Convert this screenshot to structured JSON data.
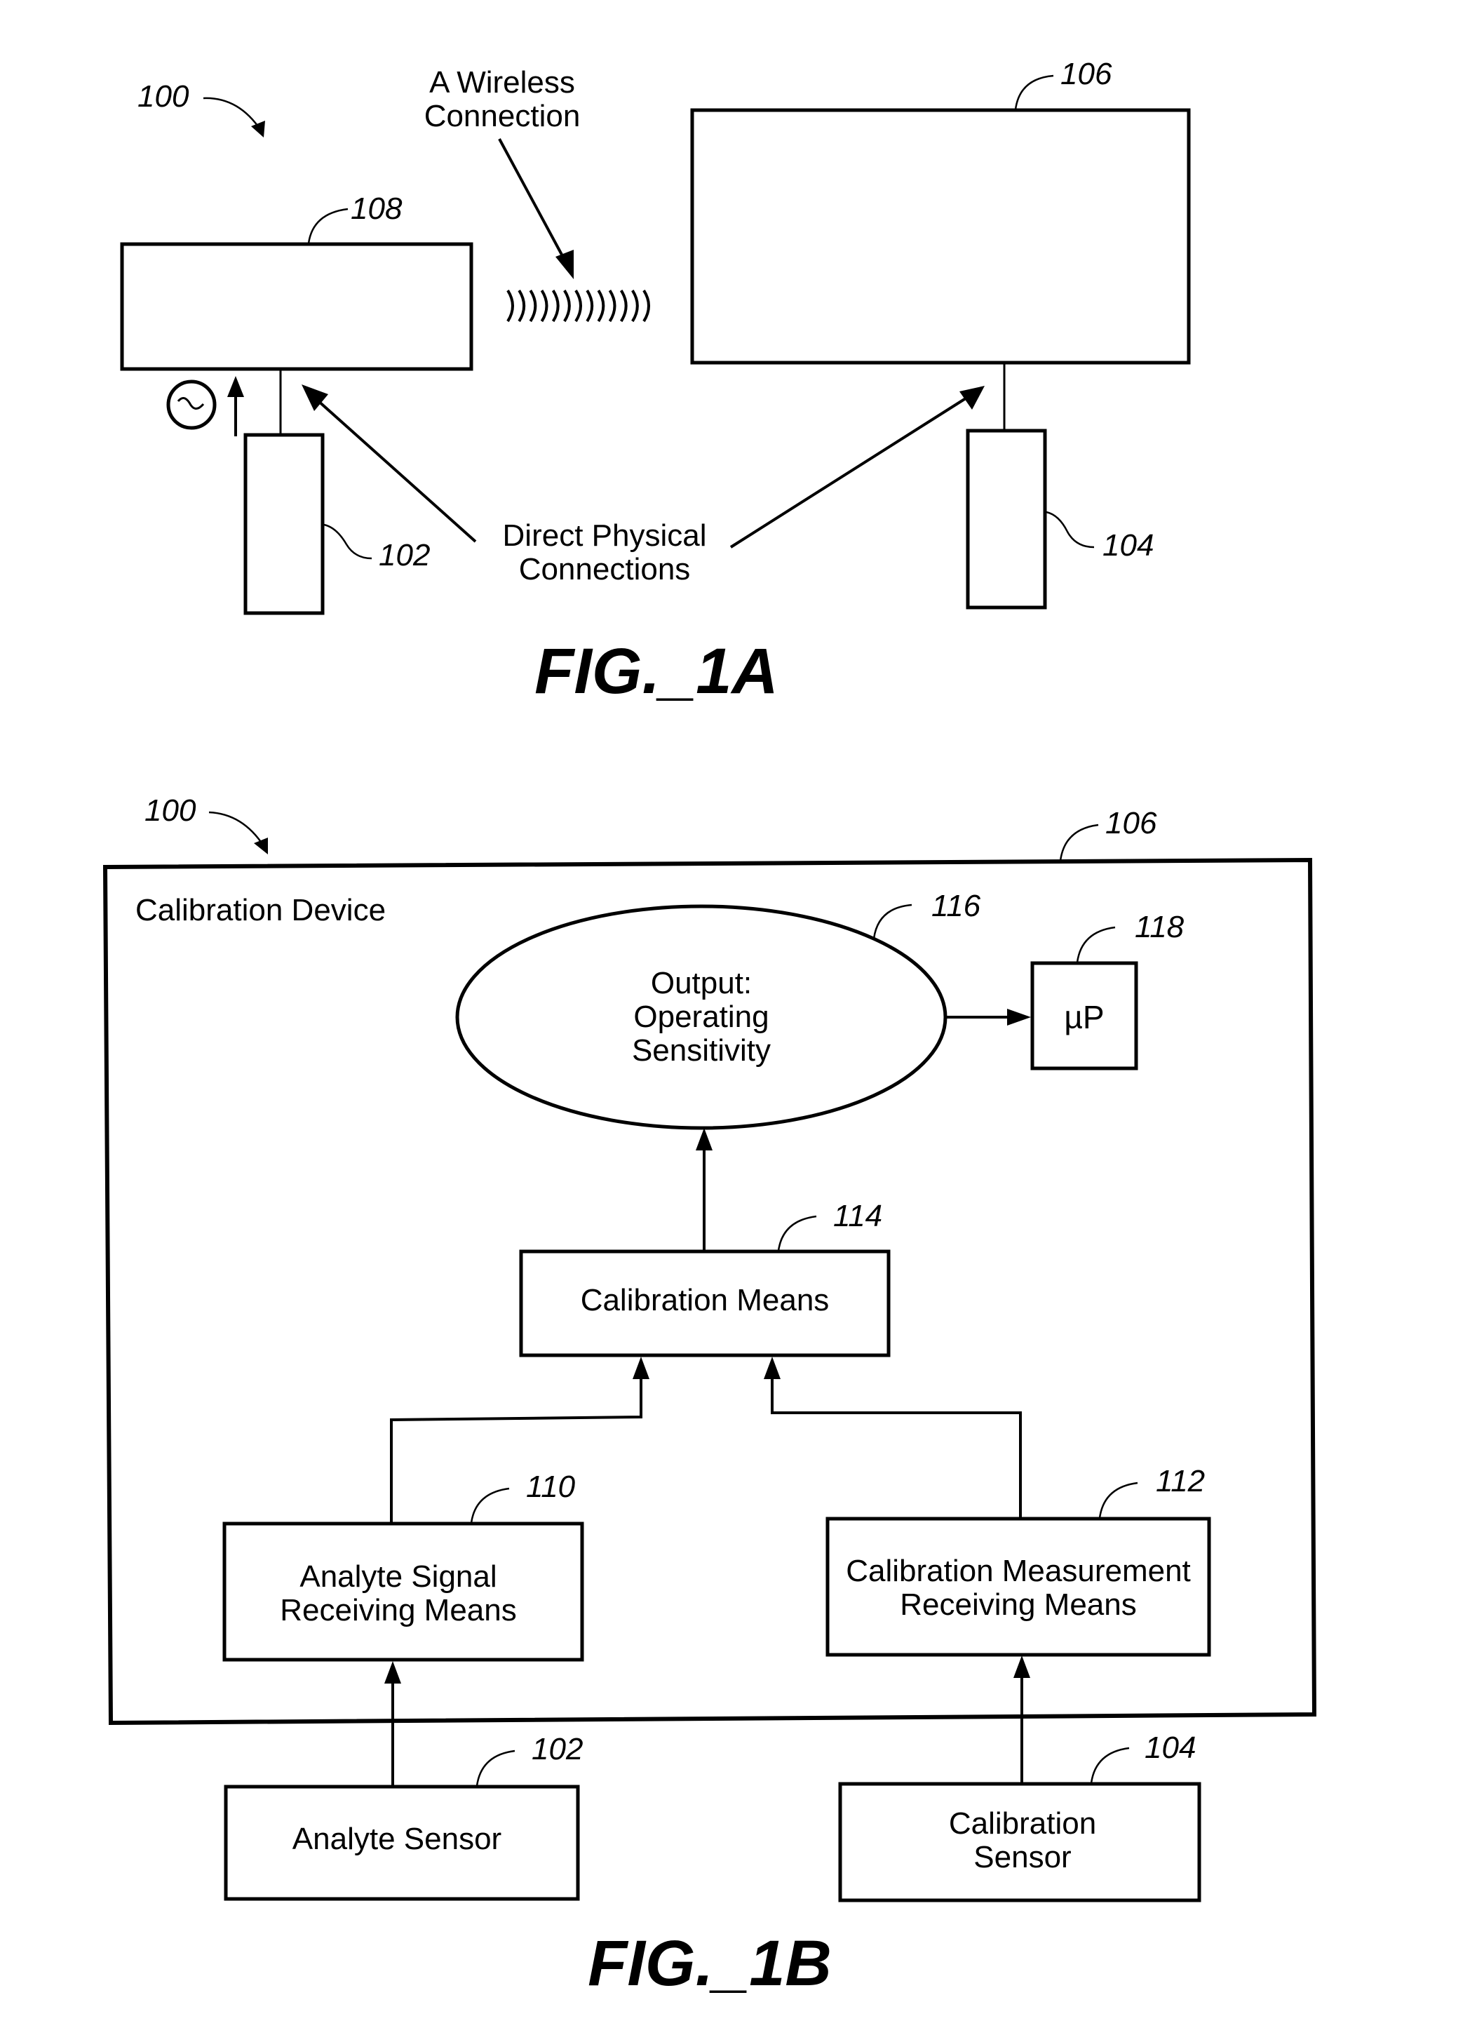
{
  "figure_1a": {
    "caption": "FIG._1A",
    "system_ref": "100",
    "wireless_label_line1": "A Wireless",
    "wireless_label_line2": "Connection",
    "physical_label_line1": "Direct Physical",
    "physical_label_line2": "Connections",
    "transmitter_ref": "108",
    "calibration_device_ref": "106",
    "analyte_sensor_ref": "102",
    "calibration_sensor_ref": "104",
    "wireless_wave_count": 13,
    "ac_source_icon": "ac-sine-source-icon"
  },
  "figure_1b": {
    "caption": "FIG._1B",
    "system_ref": "100",
    "device": {
      "label": "Calibration Device",
      "ref": "106"
    },
    "output": {
      "line1": "Output:",
      "line2": "Operating",
      "line3": "Sensitivity",
      "ref": "116"
    },
    "microprocessor": {
      "label": "µP",
      "ref": "118"
    },
    "calibration_means": {
      "label": "Calibration Means",
      "ref": "114"
    },
    "analyte_receiving": {
      "line1": "Analyte Signal",
      "line2": "Receiving Means",
      "ref": "110"
    },
    "calibration_receiving": {
      "line1": "Calibration Measurement",
      "line2": "Receiving Means",
      "ref": "112"
    },
    "analyte_sensor": {
      "label": "Analyte Sensor",
      "ref": "102"
    },
    "calibration_sensor": {
      "line1": "Calibration",
      "line2": "Sensor",
      "ref": "104"
    }
  }
}
